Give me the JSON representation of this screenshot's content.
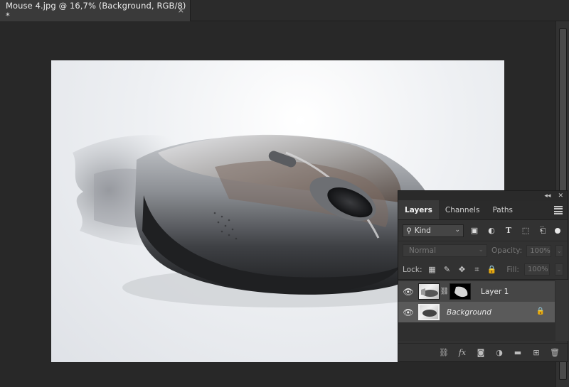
{
  "document": {
    "title": "Mouse 4.jpg @ 16,7% (Background, RGB/8) *",
    "close_glyph": "×"
  },
  "panel": {
    "collapse_glyph": "◂◂",
    "close_glyph": "✕",
    "tabs": [
      {
        "label": "Layers",
        "active": true
      },
      {
        "label": "Channels",
        "active": false
      },
      {
        "label": "Paths",
        "active": false
      }
    ],
    "filter": {
      "kind_label": "Kind",
      "icons": [
        "image-filter-icon",
        "adjustment-filter-icon",
        "type-filter-icon",
        "shape-filter-icon",
        "smart-object-filter-icon"
      ]
    },
    "blend_mode": "Normal",
    "opacity_label": "Opacity:",
    "opacity_value": "100%",
    "lock_label": "Lock:",
    "fill_label": "Fill:",
    "fill_value": "100%",
    "layers": [
      {
        "name": "Layer 1",
        "visible": true,
        "has_mask": true,
        "locked": false
      },
      {
        "name": "Background",
        "visible": true,
        "has_mask": false,
        "locked": true,
        "italic": true
      }
    ],
    "bottom_icons": [
      "link-layers-icon",
      "fx-icon",
      "add-mask-icon",
      "adjustment-layer-icon",
      "group-folder-icon",
      "new-layer-icon",
      "trash-icon"
    ],
    "fx_label": "fx"
  },
  "colors": {
    "workspace": "#282828",
    "panel": "#323232",
    "selected_layer": "#5a5a5a"
  }
}
